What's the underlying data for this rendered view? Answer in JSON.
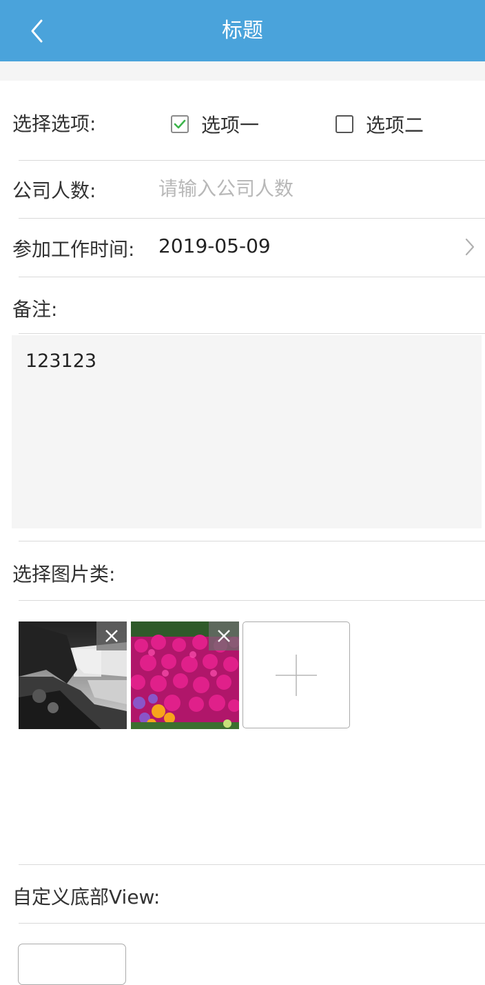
{
  "header": {
    "title": "标题",
    "back_icon": "chevron-left-icon",
    "bg_color": "#4aa3db"
  },
  "form": {
    "options": {
      "label": "选择选项:",
      "items": [
        {
          "label": "选项一",
          "checked": true
        },
        {
          "label": "选项二",
          "checked": false
        }
      ],
      "check_color": "#3cb44b"
    },
    "company_size": {
      "label": "公司人数:",
      "value": "",
      "placeholder": "请输入公司人数"
    },
    "start_date": {
      "label": "参加工作时间:",
      "value": "2019-05-09",
      "icon": "chevron-right-icon"
    },
    "remark": {
      "label": "备注:",
      "value": "123123"
    },
    "images": {
      "label": "选择图片类:",
      "items": [
        {
          "name": "waterfall-photo",
          "remove_icon": "close-icon"
        },
        {
          "name": "flowers-photo",
          "remove_icon": "close-icon"
        }
      ],
      "add_icon": "plus-icon"
    },
    "custom_footer": {
      "label": "自定义底部View:"
    }
  }
}
